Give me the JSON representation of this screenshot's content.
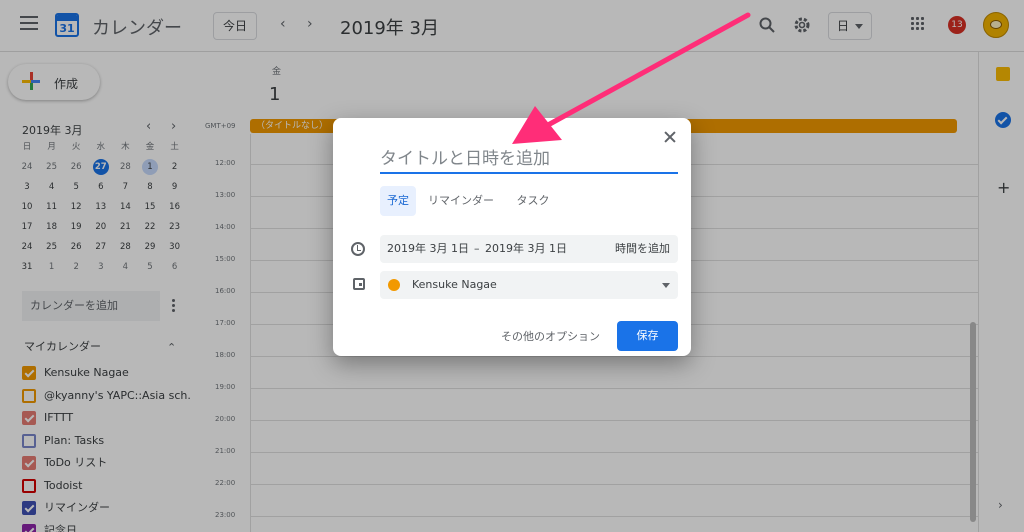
{
  "header": {
    "app_title": "カレンダー",
    "logo_day": "31",
    "today_button": "今日",
    "prev_arrow": "‹",
    "next_arrow": "›",
    "month_title": "2019年 3月",
    "view_selector": "日",
    "notification_count": "13"
  },
  "sidebar": {
    "create_label": "作成",
    "mini_calendar": {
      "title": "2019年 3月",
      "prev": "‹",
      "next": "›",
      "weekdays": [
        "日",
        "月",
        "火",
        "水",
        "木",
        "金",
        "土"
      ],
      "weeks": [
        [
          "24",
          "25",
          "26",
          "27",
          "28",
          "1",
          "2"
        ],
        [
          "3",
          "4",
          "5",
          "6",
          "7",
          "8",
          "9"
        ],
        [
          "10",
          "11",
          "12",
          "13",
          "14",
          "15",
          "16"
        ],
        [
          "17",
          "18",
          "19",
          "20",
          "21",
          "22",
          "23"
        ],
        [
          "24",
          "25",
          "26",
          "27",
          "28",
          "29",
          "30"
        ],
        [
          "31",
          "1",
          "2",
          "3",
          "4",
          "5",
          "6"
        ]
      ]
    },
    "add_calendar_placeholder": "カレンダーを追加",
    "my_calendars_title": "マイカレンダー",
    "my_calendars_toggle": "⌃",
    "calendars": [
      {
        "name": "Kensuke Nagae",
        "color": "#f29900",
        "checked": true
      },
      {
        "name": "@kyanny's YAPC::Asia sch...",
        "color": "#f29900",
        "checked": false
      },
      {
        "name": "IFTTT",
        "color": "#e67c73",
        "checked": true
      },
      {
        "name": "Plan: Tasks",
        "color": "#7986cb",
        "checked": false
      },
      {
        "name": "ToDo リスト",
        "color": "#e67c73",
        "checked": true
      },
      {
        "name": "Todoist",
        "color": "#d50000",
        "checked": false
      },
      {
        "name": "リマインダー",
        "color": "#3f51b5",
        "checked": true
      },
      {
        "name": "記念日",
        "color": "#8e24aa",
        "checked": true
      }
    ]
  },
  "main": {
    "day_name": "金",
    "day_number": "1",
    "timezone": "GMT+09",
    "allday_event": "（タイトルなし）",
    "hours": [
      "12:00",
      "13:00",
      "14:00",
      "15:00",
      "16:00",
      "17:00",
      "18:00",
      "19:00",
      "20:00",
      "21:00",
      "22:00",
      "23:00"
    ]
  },
  "rail": {
    "add": "+",
    "expand": "›"
  },
  "dialog": {
    "title_placeholder": "タイトルと日時を追加",
    "tabs": [
      "予定",
      "リマインダー",
      "タスク"
    ],
    "date_start": "2019年 3月 1日",
    "date_sep": "–",
    "date_end": "2019年 3月 1日",
    "add_time": "時間を追加",
    "calendar_name": "Kensuke Nagae",
    "more_options": "その他のオプション",
    "save": "保存"
  },
  "colors": {
    "accent": "#1a73e8",
    "event": "#f29900",
    "annotation_arrow": "#ff2d78"
  }
}
